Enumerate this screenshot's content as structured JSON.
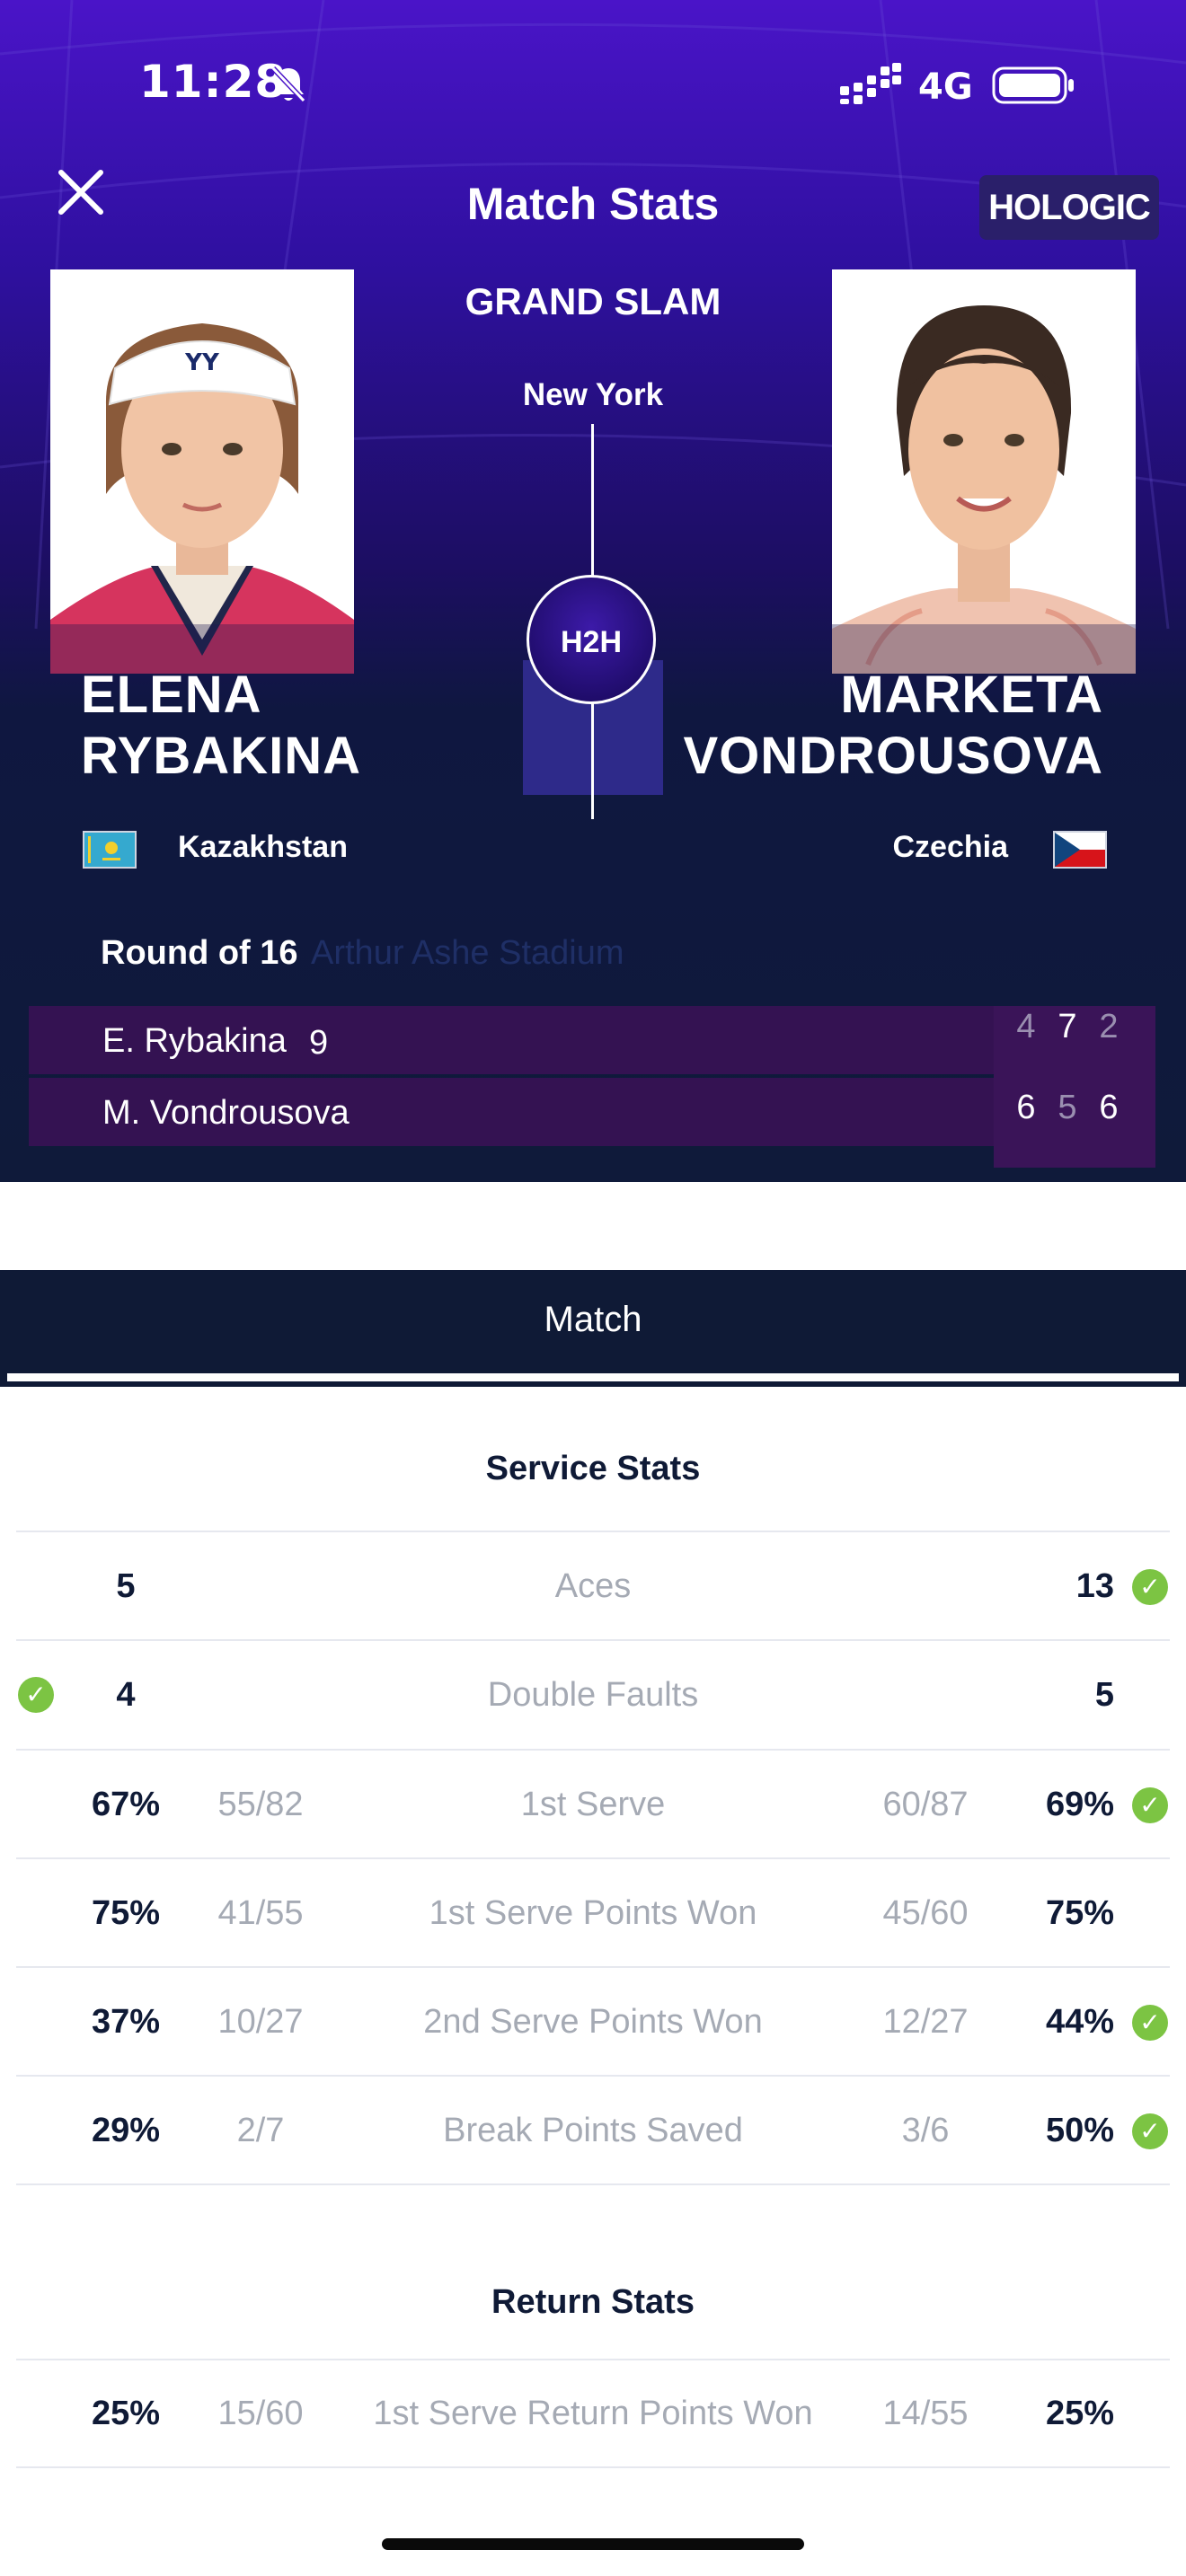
{
  "status_bar": {
    "time": "11:28",
    "network": "4G"
  },
  "header": {
    "title": "Match Stats",
    "sponsor": "HOLOGIC",
    "event": "GRAND SLAM",
    "city": "New York",
    "h2h_label": "H2H"
  },
  "players": [
    {
      "first": "ELENA",
      "last": "RYBAKINA",
      "country": "Kazakhstan",
      "short": "E. Rybakina",
      "seed": "9",
      "sets": [
        "4",
        "7",
        "2"
      ]
    },
    {
      "first": "MARKETA",
      "last": "VONDROUSOVA",
      "country": "Czechia",
      "short": "M. Vondrousova",
      "seed": "",
      "sets": [
        "6",
        "5",
        "6"
      ]
    }
  ],
  "match": {
    "round": "Round of 16",
    "venue": "Arthur Ashe Stadium"
  },
  "tabs": [
    {
      "label": "Match",
      "active": true
    }
  ],
  "service_stats": {
    "title": "Service Stats",
    "rows": [
      {
        "label": "Aces",
        "p1": "5",
        "p1_frac": "",
        "p2": "13",
        "p2_frac": "",
        "leader": "p2"
      },
      {
        "label": "Double Faults",
        "p1": "4",
        "p1_frac": "",
        "p2": "5",
        "p2_frac": "",
        "leader": "p1"
      },
      {
        "label": "1st Serve",
        "p1": "67%",
        "p1_frac": "55/82",
        "p2": "69%",
        "p2_frac": "60/87",
        "leader": "p2"
      },
      {
        "label": "1st Serve Points Won",
        "p1": "75%",
        "p1_frac": "41/55",
        "p2": "75%",
        "p2_frac": "45/60",
        "leader": ""
      },
      {
        "label": "2nd Serve Points Won",
        "p1": "37%",
        "p1_frac": "10/27",
        "p2": "44%",
        "p2_frac": "12/27",
        "leader": "p2"
      },
      {
        "label": "Break Points Saved",
        "p1": "29%",
        "p1_frac": "2/7",
        "p2": "50%",
        "p2_frac": "3/6",
        "leader": "p2"
      }
    ]
  },
  "return_stats": {
    "title": "Return Stats",
    "rows": [
      {
        "label": "1st Serve Return Points Won",
        "p1": "25%",
        "p1_frac": "15/60",
        "p2": "25%",
        "p2_frac": "14/55",
        "leader": ""
      }
    ]
  },
  "colors": {
    "accent": "#4a14c8",
    "navy": "#0f1a36",
    "win_check": "#7cc443",
    "muted": "#a5aab4"
  }
}
